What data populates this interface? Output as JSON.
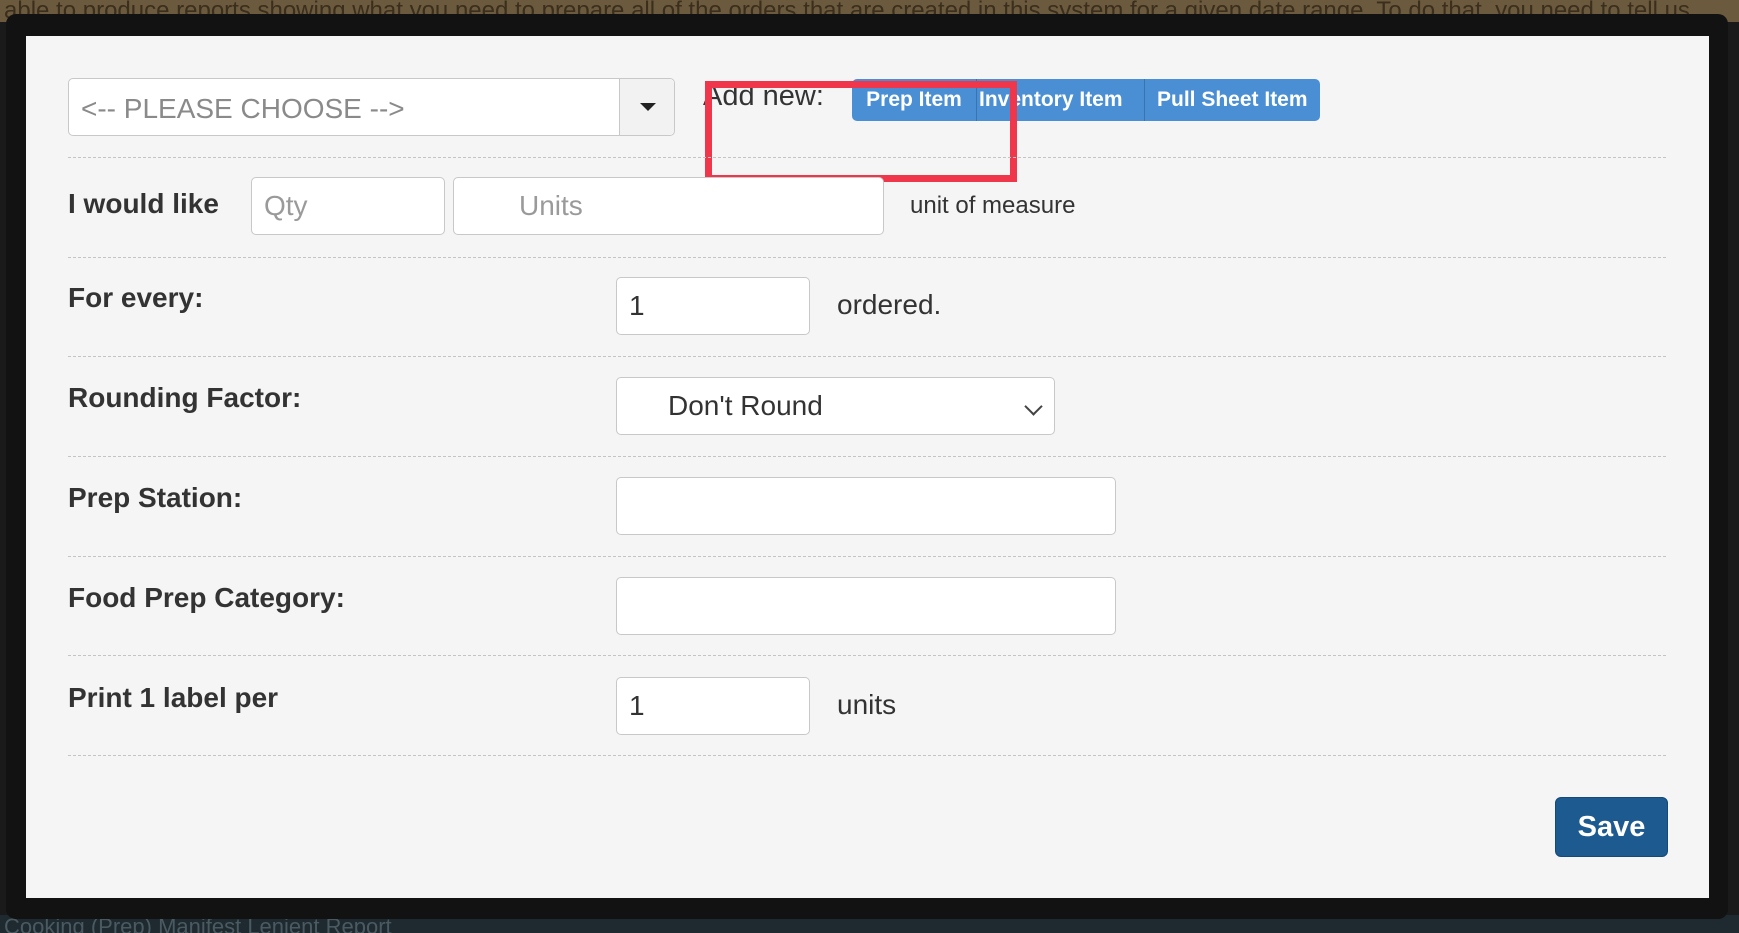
{
  "background": {
    "top_text": "able to produce reports showing what you need to prepare all of the orders that are created in this system for a given date range. To do that, you need to tell us",
    "bottom_text": "Cooking (Prep) Manifest Lenient Report"
  },
  "item_select": {
    "placeholder": "<-- PLEASE CHOOSE -->"
  },
  "add_new": {
    "label": "Add new:",
    "buttons": [
      "Prep Item",
      "Inventory Item",
      "Pull Sheet Item"
    ]
  },
  "form": {
    "would_like": {
      "label": "I would like",
      "qty_placeholder": "Qty",
      "units_placeholder": "Units",
      "suffix": "unit of measure"
    },
    "for_every": {
      "label": "For every:",
      "value": "1",
      "suffix": "ordered."
    },
    "rounding": {
      "label": "Rounding Factor:",
      "value": "Don't Round"
    },
    "prep_station": {
      "label": "Prep Station:",
      "value": ""
    },
    "food_prep_category": {
      "label": "Food Prep Category:",
      "value": ""
    },
    "print_label": {
      "label": "Print 1 label per",
      "value": "1",
      "suffix": "units"
    }
  },
  "save_label": "Save",
  "colors": {
    "accent": "#4a8fd4",
    "save": "#1c5a8f",
    "highlight": "#f0364b"
  }
}
